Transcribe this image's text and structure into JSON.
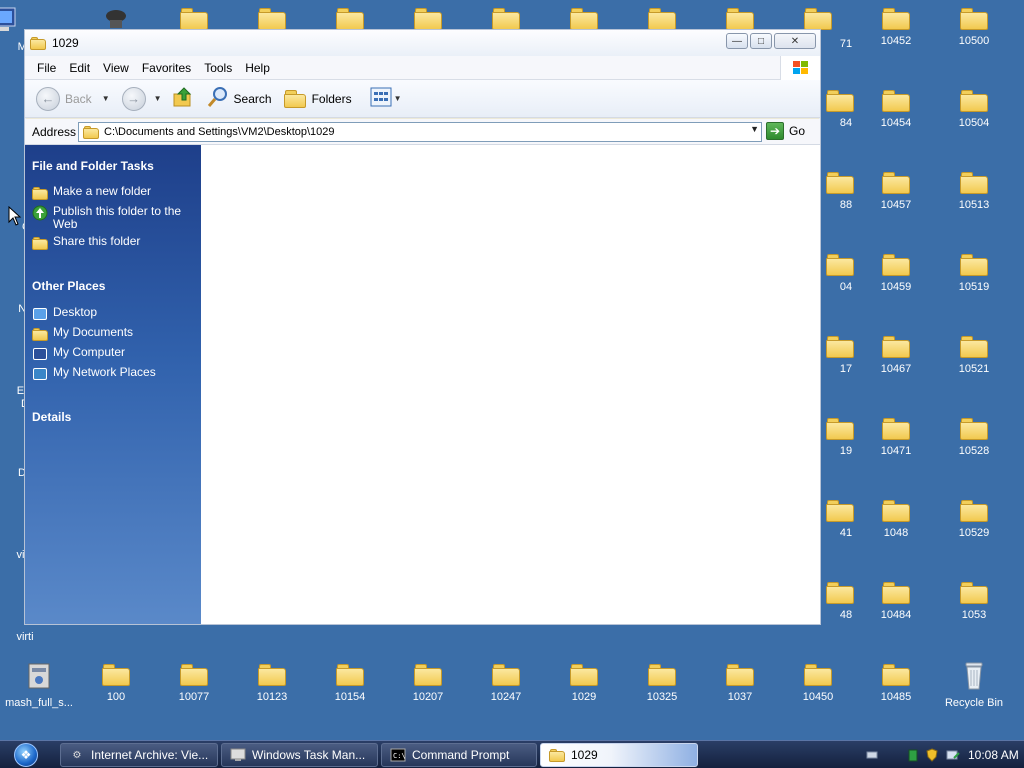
{
  "desktop": {
    "left_icons": [
      {
        "name": "my-computer",
        "label": "My",
        "icon": "computer-icon"
      },
      {
        "name": "left-n",
        "label": "N",
        "icon": "network-icon"
      },
      {
        "name": "left-c",
        "label": "C",
        "icon": "app-icon"
      },
      {
        "name": "left-nc",
        "label": "Nc",
        "icon": "app-icon"
      },
      {
        "name": "left-em",
        "label": "Em\nD",
        "icon": "app-icon"
      },
      {
        "name": "left-da",
        "label": "Da",
        "icon": "app-icon"
      },
      {
        "name": "left-virt1",
        "label": "virti",
        "icon": "app-icon"
      },
      {
        "name": "left-virt2",
        "label": "virti",
        "icon": "app-icon"
      }
    ],
    "right_col_a": [
      "10452",
      "10454",
      "10457",
      "10459",
      "10467",
      "10471",
      "1048",
      "10484"
    ],
    "right_col_b": [
      "10500",
      "10504",
      "10513",
      "10519",
      "10521",
      "10528",
      "10529",
      "1053"
    ],
    "partial_col": [
      "71",
      "84",
      "88",
      "04",
      "17",
      "19",
      "41",
      "48"
    ],
    "bottom_row": [
      {
        "label": "mash_full_s...",
        "icon": "installer-icon"
      },
      {
        "label": "100",
        "icon": "folder-icon"
      },
      {
        "label": "10077",
        "icon": "folder-icon"
      },
      {
        "label": "10123",
        "icon": "folder-icon"
      },
      {
        "label": "10154",
        "icon": "folder-icon"
      },
      {
        "label": "10207",
        "icon": "folder-icon"
      },
      {
        "label": "10247",
        "icon": "folder-icon"
      },
      {
        "label": "1029",
        "icon": "folder-icon"
      },
      {
        "label": "10325",
        "icon": "folder-icon"
      },
      {
        "label": "1037",
        "icon": "folder-icon"
      },
      {
        "label": "10450",
        "icon": "folder-icon"
      },
      {
        "label": "10485",
        "icon": "folder-icon"
      },
      {
        "label": "Recycle Bin",
        "icon": "recycle-bin-icon"
      }
    ]
  },
  "window": {
    "title": "1029",
    "menu": [
      "File",
      "Edit",
      "View",
      "Favorites",
      "Tools",
      "Help"
    ],
    "toolbar": {
      "back": "Back",
      "search": "Search",
      "folders": "Folders"
    },
    "address": {
      "label": "Address",
      "value": "C:\\Documents and Settings\\VM2\\Desktop\\1029",
      "go": "Go"
    },
    "taskpane": {
      "file_tasks_title": "File and Folder Tasks",
      "file_tasks": [
        {
          "label": "Make a new folder",
          "icon": "new-folder-icon"
        },
        {
          "label": "Publish this folder to the Web",
          "icon": "publish-web-icon"
        },
        {
          "label": "Share this folder",
          "icon": "share-folder-icon"
        }
      ],
      "other_places_title": "Other Places",
      "other_places": [
        {
          "label": "Desktop",
          "icon": "desktop-icon"
        },
        {
          "label": "My Documents",
          "icon": "my-documents-icon"
        },
        {
          "label": "My Computer",
          "icon": "my-computer-icon"
        },
        {
          "label": "My Network Places",
          "icon": "network-places-icon"
        }
      ],
      "details_title": "Details"
    }
  },
  "taskbar": {
    "buttons": [
      {
        "label": "Internet Archive: Vie...",
        "icon": "browser-icon",
        "active": false
      },
      {
        "label": "Windows Task Man...",
        "icon": "task-manager-icon",
        "active": false
      },
      {
        "label": "Command Prompt",
        "icon": "cmd-icon",
        "active": false
      },
      {
        "label": "1029",
        "icon": "folder-icon",
        "active": true
      }
    ],
    "clock": "10:08 AM",
    "colors": {
      "desktop": "#3b6ea8",
      "taskpane": "#3162ad"
    }
  }
}
